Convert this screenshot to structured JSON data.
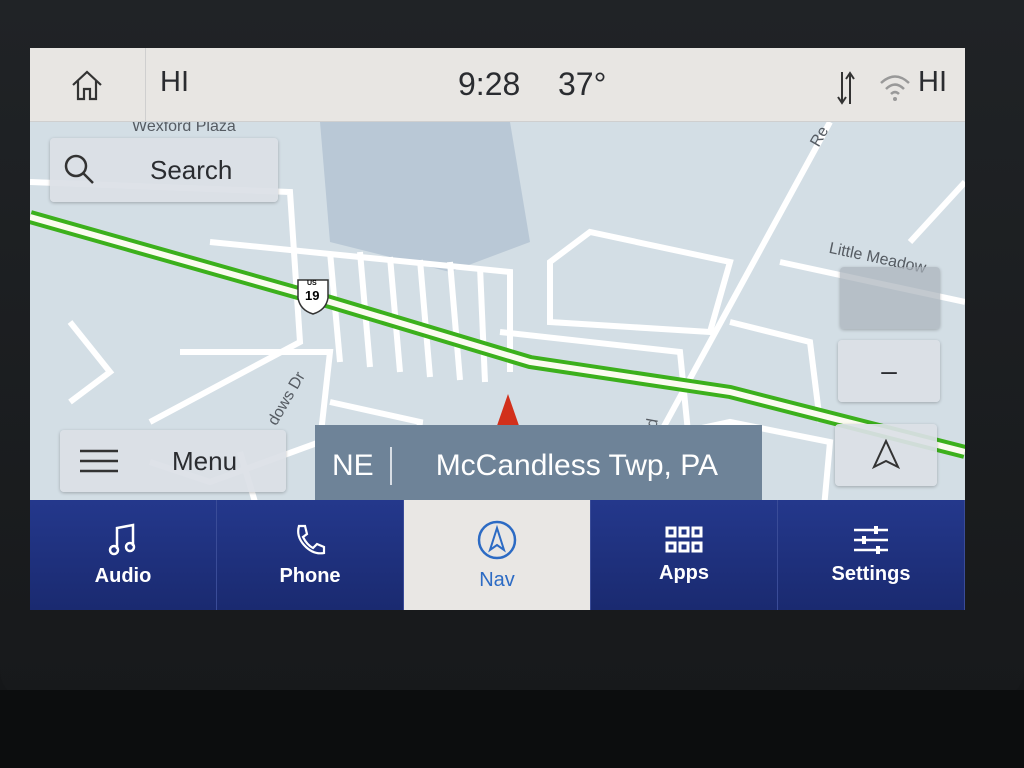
{
  "status_bar": {
    "home_icon": "home-icon",
    "left_label": "HI",
    "time": "9:28",
    "temperature": "37°",
    "data_icon": "data-transfer-icon",
    "wifi_icon": "wifi-icon",
    "right_label": "HI"
  },
  "map": {
    "labels": {
      "place": "Wexford Plaza",
      "road_right": "Little Meadow",
      "road_left": "dows Dr",
      "road_top": "Re",
      "road_mid": "Rd",
      "route_shield": "19",
      "route_shield_top": "US"
    },
    "route_color": "#3cb01c",
    "search_label": "Search",
    "menu_label": "Menu",
    "zoom_out_label": "–",
    "heading": "NE",
    "location": "McCandless Twp, PA"
  },
  "nav_bar": {
    "items": [
      {
        "label": "Audio",
        "icon": "music-note-icon"
      },
      {
        "label": "Phone",
        "icon": "phone-icon"
      },
      {
        "label": "Nav",
        "icon": "navigation-icon",
        "active": true
      },
      {
        "label": "Apps",
        "icon": "apps-grid-icon"
      },
      {
        "label": "Settings",
        "icon": "sliders-icon"
      }
    ]
  }
}
